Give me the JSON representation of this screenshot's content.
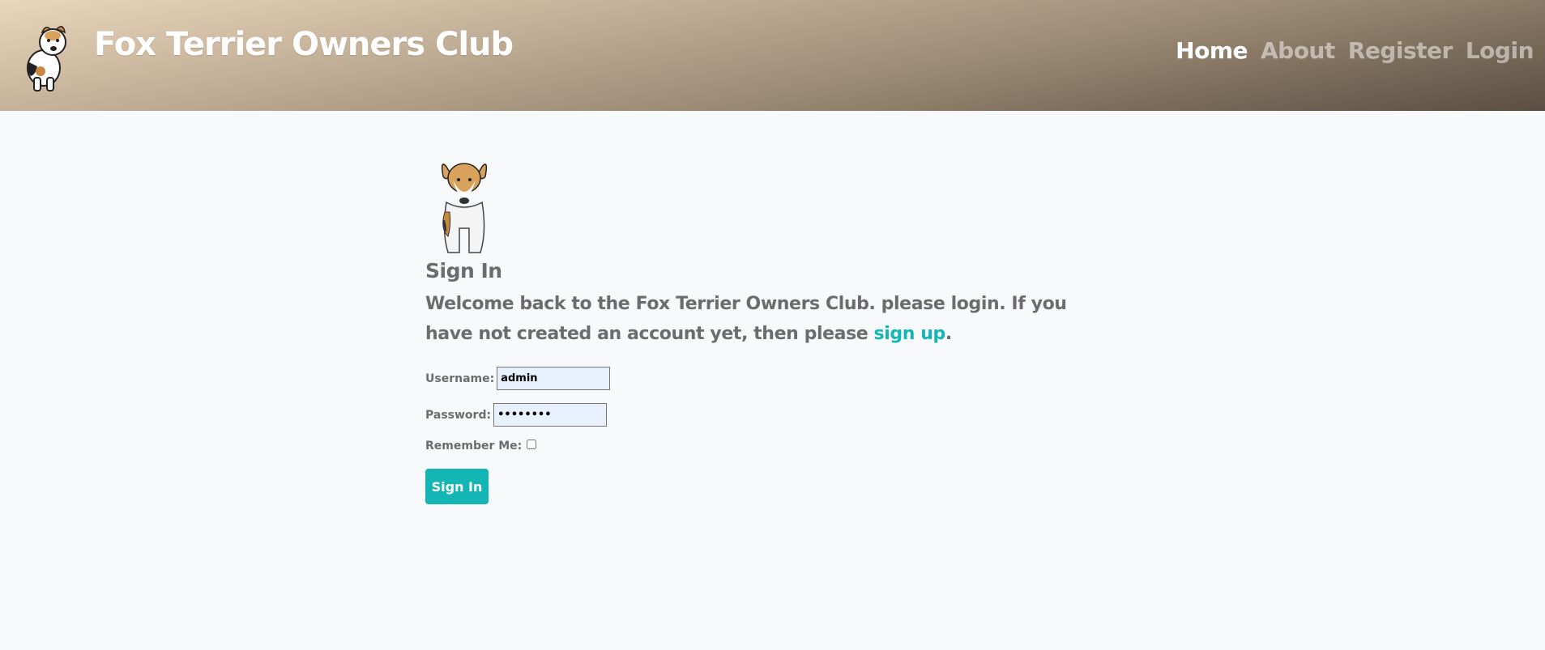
{
  "header": {
    "site_title": "Fox Terrier Owners Club",
    "nav": [
      {
        "label": "Home",
        "active": true
      },
      {
        "label": "About",
        "active": false
      },
      {
        "label": "Register",
        "active": false
      },
      {
        "label": "Login",
        "active": false
      }
    ]
  },
  "main": {
    "heading": "Sign In",
    "welcome_text": "Welcome back to the Fox Terrier Owners Club. please login. If you have not created an account yet, then please ",
    "signup_link": "sign up",
    "welcome_end": ".",
    "form": {
      "username_label": "Username:",
      "username_value": "admin",
      "password_label": "Password:",
      "password_value": "••••••••",
      "remember_label": "Remember Me:",
      "remember_checked": false,
      "submit_label": "Sign In"
    }
  },
  "colors": {
    "accent": "#14b5b5",
    "text": "#6c6c6c",
    "background": "#f8f9fa"
  }
}
